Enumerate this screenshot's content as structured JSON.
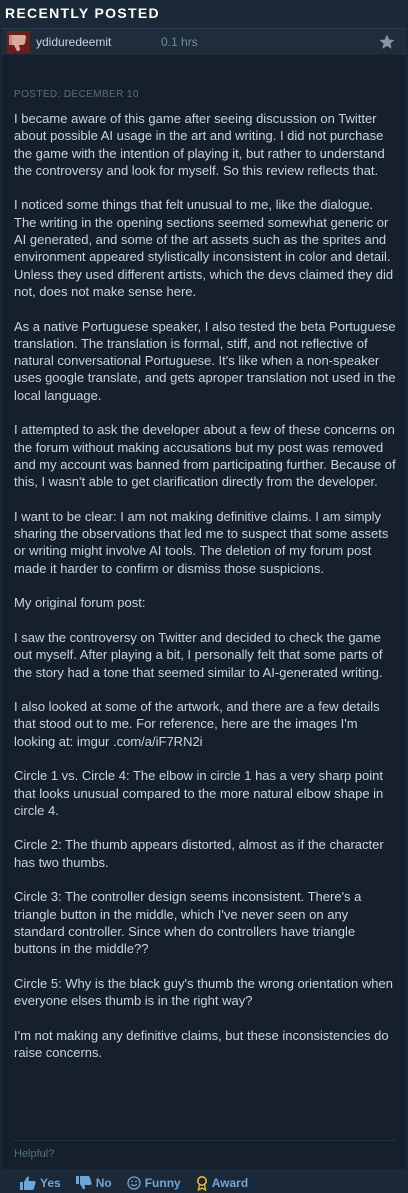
{
  "section": {
    "title": "RECENTLY POSTED"
  },
  "review": {
    "reviewer": "ydiduredeemit",
    "hours": "0.1 hrs",
    "posted": "POSTED: DECEMBER 10",
    "paragraphs": [
      "I became aware of this game after seeing discussion on Twitter about possible AI usage in the art and writing. I did not purchase the game with the intention of playing it, but rather to understand the controversy and look for myself. So this review reflects that.",
      "I noticed some things that felt unusual to me, like the dialogue. The writing in the opening sections seemed somewhat generic or AI generated, and some of the art assets such as the sprites and environment appeared stylistically inconsistent in color and detail. Unless they used different artists, which the devs claimed they did not, does not make sense here.",
      "As a native Portuguese speaker, I also tested the beta Portuguese translation. The translation is formal, stiff, and not reflective of natural conversational Portuguese. It's like when a non-speaker uses google translate, and gets aproper translation not used in the local language.",
      "I attempted to ask the developer about a few of these concerns on the forum without making accusations but my post was removed and my account was banned from participating further. Because of this, I wasn't able to get clarification directly from the developer.",
      "I want to be clear: I am not making definitive claims. I am simply sharing the observations that led me to suspect that some assets or writing might involve AI tools. The deletion of my forum post made it harder to confirm or dismiss those suspicions.",
      "My original forum post:",
      "I saw the controversy on Twitter and decided to check the game out myself. After playing a bit, I personally felt that some parts of the story had a tone that seemed similar to AI-generated writing.",
      "I also looked at some of the artwork, and there are a few details that stood out to me. For reference, here are the images I'm looking at: imgur .com/a/iF7RN2i",
      "Circle 1 vs. Circle 4: The elbow in circle 1 has a very sharp point that looks unusual compared to the more natural elbow shape in circle 4.",
      "Circle 2: The thumb appears distorted, almost as if the character has two thumbs.",
      "Circle 3: The controller design seems inconsistent. There's a triangle button in the middle, which I've never seen on any standard controller. Since when do controllers have triangle buttons in the middle??",
      "Circle 5: Why is the black guy's thumb the wrong orientation when everyone elses thumb is in the right way?",
      "I'm not making any definitive claims, but these inconsistencies do raise concerns."
    ],
    "helpful_label": "Helpful?",
    "actions": {
      "yes": "Yes",
      "no": "No",
      "funny": "Funny",
      "award": "Award"
    }
  },
  "colors": {
    "background": "#1b2838",
    "review_bg": "#16202d",
    "link": "#6fa6d8",
    "text": "#c6d4df",
    "thumbs_down_avatar": "#7c2a2a"
  },
  "icons": [
    "thumbs-down-icon",
    "star-icon",
    "thumbs-up-icon",
    "smiley-icon",
    "award-icon"
  ]
}
